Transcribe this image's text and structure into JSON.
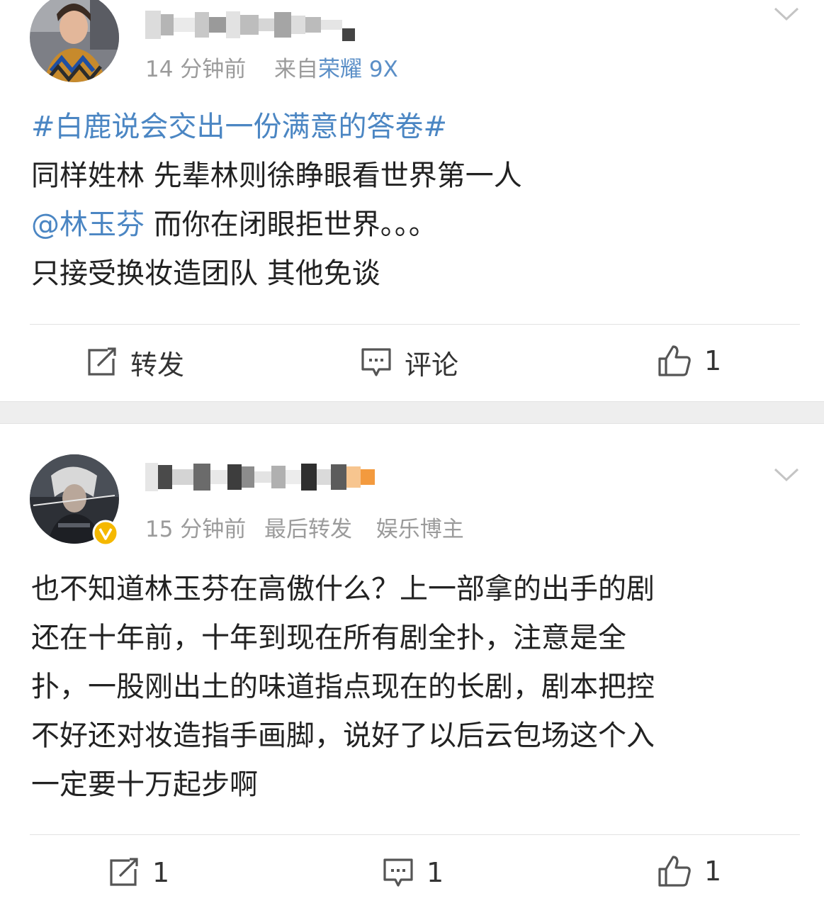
{
  "posts": [
    {
      "time": "14 分钟前",
      "source_prefix": "来自",
      "source_device": "荣耀 9X",
      "hashtag": "#白鹿说会交出一份满意的答卷#",
      "line1": "同样姓林 先辈林则徐睁眼看世界第一人",
      "mention": "@林玉芬",
      "line2_rest": " 而你在闭眼拒世界。。。",
      "line3": "只接受换妆造团队 其他免谈",
      "repost_label": "转发",
      "comment_label": "评论",
      "like_count": "1"
    },
    {
      "time": "15 分钟前",
      "extra": "最后转发",
      "badge_text": "娱乐博主",
      "lines": [
        "也不知道林玉芬在高傲什么？上一部拿的出手的剧",
        "还在十年前，十年到现在所有剧全扑，注意是全",
        "扑，一股刚出土的味道指点现在的长剧，剧本把控",
        "不好还对妆造指手画脚，说好了以后云包场这个入",
        "一定要十万起步啊"
      ],
      "repost_count": "1",
      "comment_count": "1",
      "like_count": "1"
    }
  ],
  "colors": {
    "link": "#4b86c3",
    "meta": "#9b9b9b",
    "text": "#222222",
    "separator": "#eeeeee",
    "verified": "#f5b800"
  },
  "icons": [
    "avatar",
    "chevron-down-icon",
    "repost-icon",
    "comment-icon",
    "like-icon",
    "verified-badge-icon"
  ]
}
